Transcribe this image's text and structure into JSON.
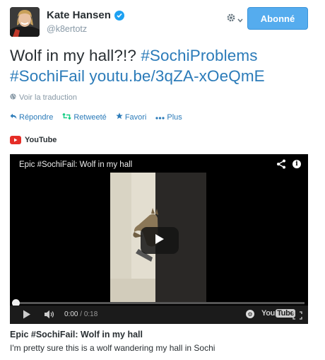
{
  "user": {
    "display_name": "Kate Hansen",
    "handle": "@k8ertotz",
    "verified": true,
    "follow_label": "Abonné"
  },
  "tweet": {
    "text_plain": "Wolf in my hall?!? ",
    "hashtag1": "#SochiProblems",
    "hashtag2": "#SochiFail",
    "link": "youtu.be/3qZA-xOeQmE",
    "translate_label": "Voir la traduction"
  },
  "actions": {
    "reply": "Répondre",
    "retweet": "Retweeté",
    "favorite": "Favori",
    "more": "Plus"
  },
  "card": {
    "source": "YouTube",
    "player_title": "Epic #SochiFail: Wolf in my hall",
    "time_current": "0:00",
    "time_separator": " / ",
    "time_duration": "0:18",
    "progress_fraction": 0.0,
    "brand_you": "You",
    "brand_tube": "Tube",
    "title": "Epic #SochiFail: Wolf in my hall",
    "description": "I'm pretty sure this is a wolf wandering my hall in Sochi"
  },
  "colors": {
    "link": "#2b7bb9",
    "follow_button": "#55acee",
    "verified": "#1da1f2",
    "youtube_red": "#e52d27"
  },
  "icons": {
    "verified": "verified-badge-icon",
    "gear": "gear-icon",
    "globe": "globe-icon",
    "reply": "reply-icon",
    "retweet": "retweet-icon",
    "favorite": "star-icon",
    "more": "more-dots-icon",
    "share": "share-icon",
    "info": "info-icon",
    "play": "play-icon",
    "volume": "volume-icon",
    "fullscreen": "fullscreen-icon"
  }
}
